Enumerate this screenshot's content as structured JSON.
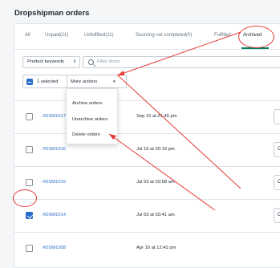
{
  "page": {
    "title": "Dropshipman orders"
  },
  "tabs": [
    {
      "label": "All"
    },
    {
      "label": "Unpaid(11)"
    },
    {
      "label": "Unfulfilled(11)"
    },
    {
      "label": "Sourcing not completed(0)"
    },
    {
      "label": "Fulfilled"
    },
    {
      "label": "Archived"
    }
  ],
  "filters": {
    "product_select": "Product keywords",
    "search_placeholder": "Filter items"
  },
  "bulk": {
    "selected_label": "1 selected",
    "more_actions_label": "More actions"
  },
  "dropdown": {
    "items": [
      {
        "label": "Archive orders"
      },
      {
        "label": "Unarchive orders"
      },
      {
        "label": "Delete orders"
      }
    ]
  },
  "orders": [
    {
      "id": "#DSM1017",
      "date": "Sep 15 at 21:45 pm",
      "checked": false
    },
    {
      "id": "#DSM1016",
      "date": "Jul 15 at 20:19 pm",
      "checked": false
    },
    {
      "id": "#DSM1015",
      "date": "Jul 03 at 03:58 am",
      "checked": false
    },
    {
      "id": "#DSM1014",
      "date": "Jul 03 at 03:41 am",
      "checked": true
    },
    {
      "id": "#DSM1008",
      "date": "Apr 10 at 12:41 pm",
      "checked": false
    }
  ],
  "row_button_label": "C",
  "colors": {
    "accent_blue": "#2c6ecb",
    "tab_active_underline": "#008060",
    "annotation_red": "#e53935"
  }
}
